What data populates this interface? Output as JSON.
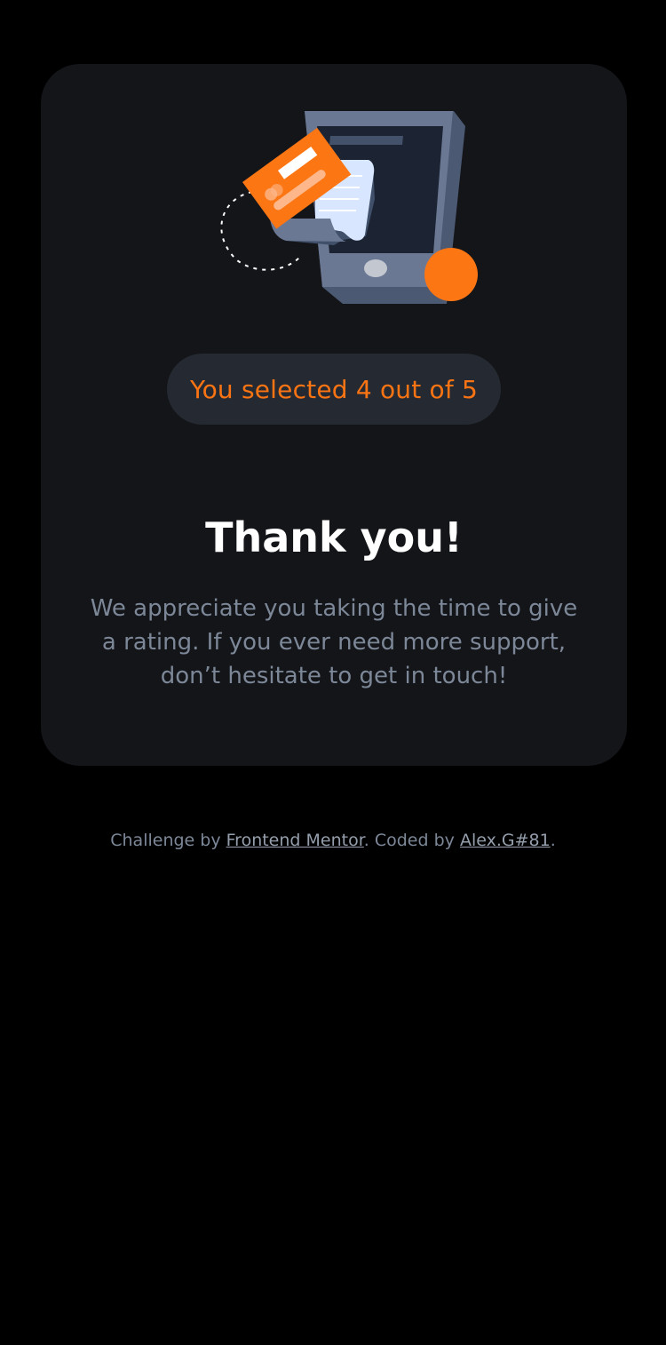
{
  "card": {
    "illustration_name": "phone-payment-illustration",
    "selection_badge": "You selected 4 out of 5",
    "title": "Thank you!",
    "message": "We appreciate you taking the time to give a rating. If you ever need more support, don’t hesitate to get in touch!"
  },
  "rating": {
    "selected": 4,
    "max": 5
  },
  "footer": {
    "prefix": "Challenge by ",
    "challenge_link": "Frontend Mentor",
    "middle": ". Coded by ",
    "author_link": "Alex.G#81",
    "suffix": "."
  },
  "colors": {
    "background": "#000000",
    "card": "#141519",
    "accent": "#fb7413",
    "badge_bg": "#252a32",
    "text_muted": "#7c8798",
    "heading": "#ffffff"
  }
}
